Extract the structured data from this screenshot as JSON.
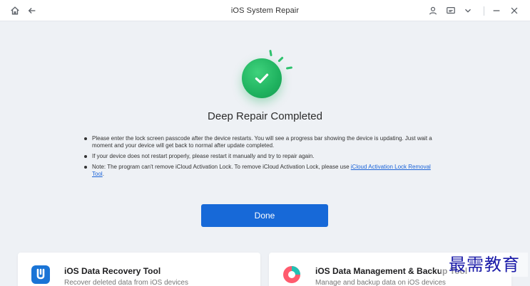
{
  "window": {
    "title": "iOS System Repair"
  },
  "status": {
    "heading": "Deep Repair Completed"
  },
  "notes": {
    "item1": "Please enter the lock screen passcode after the device restarts. You will see a progress bar showing the device is updating. Just wait a moment and your device will get back to normal after update completed.",
    "item2": "If your device does not restart properly, please restart it manually and try to repair again.",
    "item3_prefix": "Note: The program can't remove iCloud Activation Lock. To remove iCloud Activation Lock, please use ",
    "item3_link": "iCloud Activation Lock Removal Tool",
    "item3_suffix": "."
  },
  "actions": {
    "done_label": "Done"
  },
  "cards": [
    {
      "title": "iOS Data Recovery Tool",
      "description": "Recover deleted data from iOS devices",
      "icon": "data-recovery-icon"
    },
    {
      "title": "iOS Data Management & Backup Tool",
      "description": "Manage and backup data on iOS devices",
      "icon": "data-management-icon"
    }
  ],
  "watermark": {
    "text": "最需教育"
  },
  "colors": {
    "accent": "#1769d8",
    "success": "#1fb25f",
    "link": "#1a63d8"
  }
}
